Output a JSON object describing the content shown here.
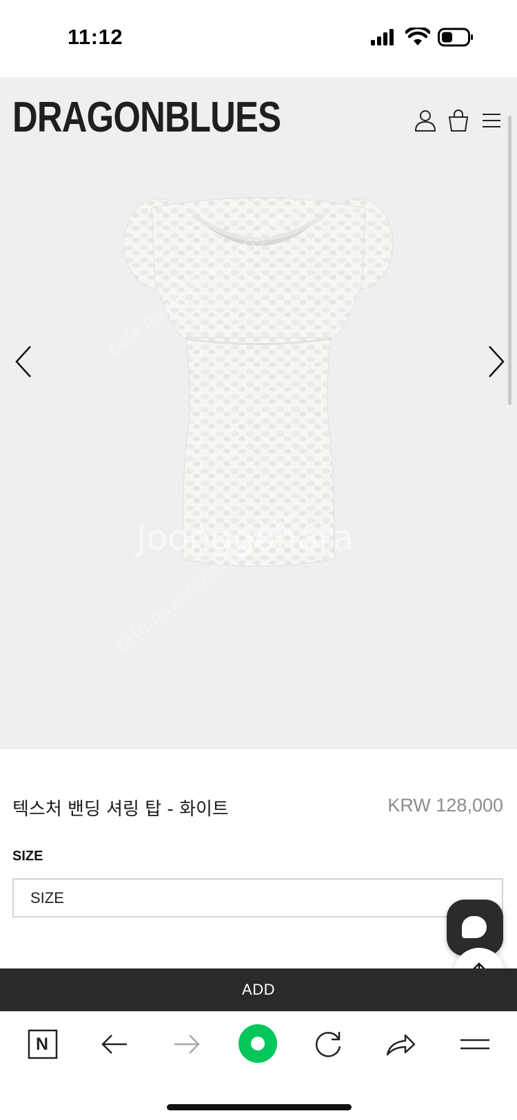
{
  "status_bar": {
    "time": "11:12"
  },
  "header": {
    "brand": "DRAGONBLUES"
  },
  "watermark": {
    "text": "Joonggonara",
    "site": "cafe.naver.com/joonggonara"
  },
  "product": {
    "name": "텍스처 밴딩 셔링 탑 - 화이트",
    "price": "KRW 128,000",
    "color": "#ffffff"
  },
  "options": {
    "size_label": "SIZE",
    "size_selected": "SIZE"
  },
  "actions": {
    "add_label": "ADD"
  },
  "browser": {
    "home_letter": "N",
    "accent": "#03c75a"
  },
  "colors": {
    "hero_bg": "#efefef",
    "add_bar": "#2a2a2a",
    "price": "#8c8c8c"
  }
}
